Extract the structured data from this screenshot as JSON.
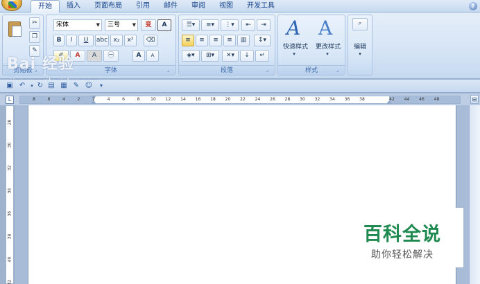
{
  "tabs": [
    {
      "label": "开始",
      "active": true
    },
    {
      "label": "插入"
    },
    {
      "label": "页面布局"
    },
    {
      "label": "引用"
    },
    {
      "label": "邮件"
    },
    {
      "label": "审阅"
    },
    {
      "label": "视图"
    },
    {
      "label": "开发工具"
    }
  ],
  "ribbon": {
    "clipboard": {
      "label": "剪贴板"
    },
    "font": {
      "label": "字体",
      "font_name": "宋体",
      "font_size": "三号",
      "bold": "B",
      "italic": "I",
      "underline": "U",
      "grow": "A",
      "shrink": "A",
      "phonetic": "变",
      "border_char": "A",
      "color_a": "A",
      "char_shading": "A"
    },
    "paragraph": {
      "label": "段落"
    },
    "styles": {
      "label": "样式",
      "quick_styles": "快速样式",
      "change_styles": "更改样式"
    },
    "editing": {
      "label": "编辑"
    }
  },
  "ruler": {
    "ticks": [
      "8",
      "6",
      "4",
      "2",
      "2",
      "4",
      "6",
      "8",
      "10",
      "12",
      "14",
      "16",
      "18",
      "20",
      "22",
      "24",
      "26",
      "28",
      "30",
      "32",
      "34",
      "36",
      "38",
      "42",
      "44",
      "46",
      "48"
    ]
  },
  "vruler": {
    "ticks": [
      "28",
      "30",
      "32",
      "34",
      "36",
      "38",
      "40",
      "42"
    ]
  },
  "watermark": {
    "baidu": "Bai 经验",
    "url": "jingyan.baidu.com",
    "title": "百科全说",
    "subtitle": "助你轻松解决"
  },
  "icons": {
    "help": "?",
    "cut": "✂",
    "find": "🔍"
  }
}
